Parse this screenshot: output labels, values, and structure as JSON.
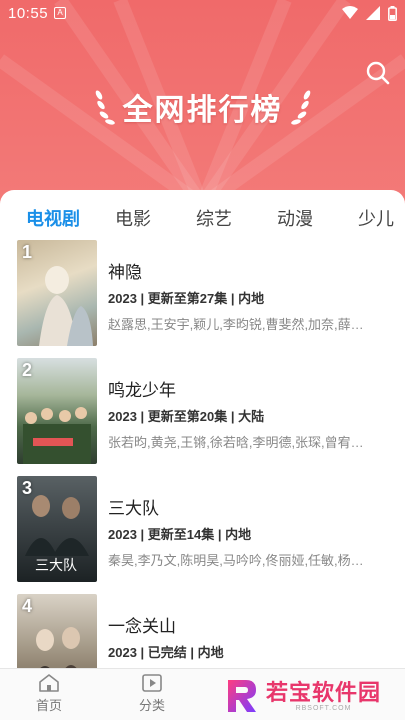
{
  "status_bar": {
    "time": "10:55",
    "notification_glyph": "A"
  },
  "header": {
    "title": "全网排行榜",
    "accent_color": "#f06a6a"
  },
  "tabs": [
    {
      "label": "电视剧",
      "active": true
    },
    {
      "label": "电影",
      "active": false
    },
    {
      "label": "综艺",
      "active": false
    },
    {
      "label": "动漫",
      "active": false
    },
    {
      "label": "少儿",
      "active": false
    }
  ],
  "rankings": [
    {
      "rank": "1",
      "name": "神隐",
      "meta": "2023 | 更新至第27集 | 内地",
      "cast": "赵露思,王安宇,颖儿,李昀锐,曹斐然,加奈,薛…"
    },
    {
      "rank": "2",
      "name": "鸣龙少年",
      "meta": "2023 | 更新至第20集 | 大陆",
      "cast": "张若昀,黄尧,王锵,徐若晗,李明德,张琛,曾宥…"
    },
    {
      "rank": "3",
      "name": "三大队",
      "meta": "2023 | 更新至14集 | 内地",
      "cast": "秦昊,李乃文,陈明昊,马吟吟,佟丽娅,任敏,杨…"
    },
    {
      "rank": "4",
      "name": "一念关山",
      "meta": "2023 | 已完结 | 内地",
      "cast": ""
    }
  ],
  "bottom_nav": [
    {
      "label": "首页",
      "icon": "home-icon"
    },
    {
      "label": "分类",
      "icon": "play-square-icon"
    }
  ],
  "watermark": {
    "main": "若宝软件园",
    "sub": "RBSOFT.COM"
  }
}
